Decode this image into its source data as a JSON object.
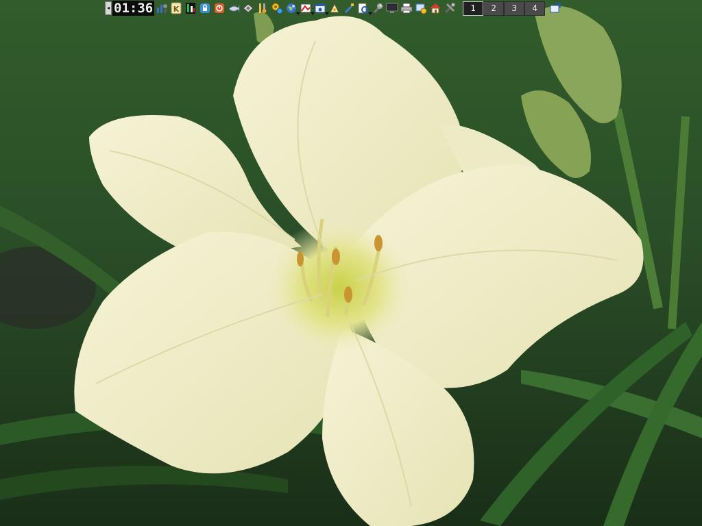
{
  "panel": {
    "clock_text": "01:36",
    "launchers": [
      {
        "icon": "network-monitor-icon"
      },
      {
        "icon": "kde-k-icon"
      },
      {
        "icon": "cpu-meter-icon"
      },
      {
        "icon": "lock-screen-icon"
      },
      {
        "icon": "logout-icon"
      },
      {
        "icon": "fish-icon"
      },
      {
        "icon": "package-icon"
      },
      {
        "icon": "tools-icon"
      },
      {
        "icon": "settings-gears-icon"
      },
      {
        "icon": "globe-icon",
        "menu": true
      },
      {
        "icon": "graphics-icon",
        "menu": true
      },
      {
        "icon": "window-icon",
        "menu": true
      },
      {
        "icon": "applet-icon"
      },
      {
        "icon": "paint-icon"
      },
      {
        "icon": "document-search-icon",
        "menu": true
      },
      {
        "icon": "wrench-icon"
      },
      {
        "icon": "terminal-icon"
      },
      {
        "icon": "printer-icon"
      },
      {
        "icon": "system-settings-icon"
      },
      {
        "icon": "home-icon"
      },
      {
        "icon": "config-tools-icon"
      }
    ],
    "workspaces": [
      "1",
      "2",
      "3",
      "4"
    ],
    "active_workspace": 0,
    "trailing_icon": "desktop-switch-icon"
  },
  "colors": {
    "flower": "#f0ecc4",
    "flower_center": "#d6dc6a",
    "leaf": "#3f7a2f",
    "lawn": "#2f5b2b"
  }
}
